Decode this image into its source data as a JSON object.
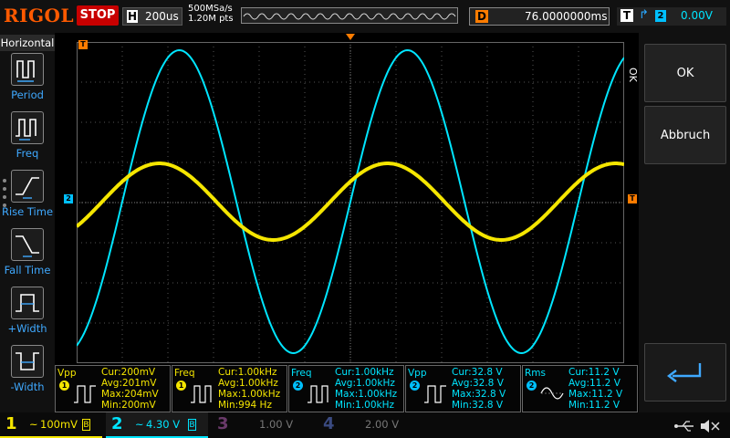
{
  "header": {
    "brand": "RIGOL",
    "run_state": "STOP",
    "horizontal_letter": "H",
    "timebase": "200us",
    "sample_rate": "500MSa/s",
    "memory_depth": "1.20M pts",
    "delay_letter": "D",
    "delay": "76.0000000ms",
    "trigger_letter": "T",
    "trigger_edge": "rising-edge-icon",
    "trigger_source": "2",
    "trigger_level": "0.00V"
  },
  "sidebar": {
    "title": "Horizontal",
    "items": [
      {
        "label": "Period",
        "icon": "period-icon"
      },
      {
        "label": "Freq",
        "icon": "frequency-icon"
      },
      {
        "label": "Rise Time",
        "icon": "rise-time-icon"
      },
      {
        "label": "Fall Time",
        "icon": "fall-time-icon"
      },
      {
        "label": "+Width",
        "icon": "positive-width-icon"
      },
      {
        "label": "-Width",
        "icon": "negative-width-icon"
      }
    ]
  },
  "right_menu": {
    "side_tab": "OK",
    "ok_label": "OK",
    "cancel_label": "Abbruch",
    "return_icon": "return-arrow-icon"
  },
  "markers": {
    "trigger_pos": "T",
    "ch2_offset": "2",
    "trigger_level": "T"
  },
  "measurements": [
    {
      "name": "Vpp",
      "channel": "1",
      "color": "yellow",
      "cur": "Cur:200mV",
      "avg": "Avg:201mV",
      "max": "Max:204mV",
      "min": "Min:200mV"
    },
    {
      "name": "Freq",
      "channel": "1",
      "color": "yellow",
      "cur": "Cur:1.00kHz",
      "avg": "Avg:1.00kHz",
      "max": "Max:1.00kHz",
      "min": "Min:994 Hz"
    },
    {
      "name": "Freq",
      "channel": "2",
      "color": "cyan",
      "cur": "Cur:1.00kHz",
      "avg": "Avg:1.00kHz",
      "max": "Max:1.00kHz",
      "min": "Min:1.00kHz"
    },
    {
      "name": "Vpp",
      "channel": "2",
      "color": "cyan",
      "cur": "Cur:32.8 V",
      "avg": "Avg:32.8 V",
      "max": "Max:32.8 V",
      "min": "Min:32.8 V"
    },
    {
      "name": "Rms",
      "channel": "2",
      "color": "cyan",
      "cur": "Cur:11.2 V",
      "avg": "Avg:11.2 V",
      "max": "Max:11.2 V",
      "min": "Min:11.2 V"
    }
  ],
  "channels": [
    {
      "num": "1",
      "coupling": "~",
      "scale": "100mV",
      "color": "#f5e600",
      "active": true
    },
    {
      "num": "2",
      "coupling": "~",
      "scale": "4.30 V",
      "color": "#00e5ff",
      "active": true
    },
    {
      "num": "3",
      "coupling": "",
      "scale": "1.00 V",
      "color": "#b04ab0",
      "active": false
    },
    {
      "num": "4",
      "coupling": "",
      "scale": "2.00 V",
      "color": "#3a66d0",
      "active": false
    }
  ],
  "status_icons": [
    "usb-icon",
    "speaker-muted-icon"
  ],
  "colors": {
    "ch1": "#f5e600",
    "ch2": "#00e5ff",
    "brand": "#ff5a00",
    "stop": "#c80000",
    "label_blue": "#3fa9ff"
  }
}
